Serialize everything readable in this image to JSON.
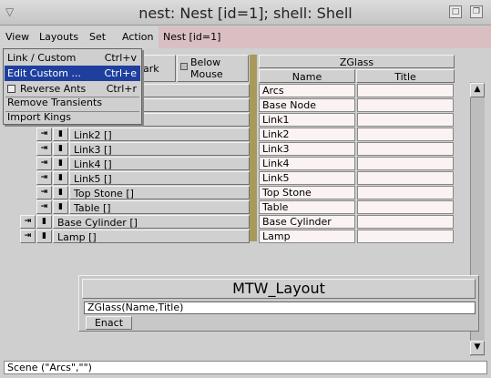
{
  "window": {
    "title": "nest: Nest [id=1]; shell: Shell",
    "menu_icon": "triangle-down-icon",
    "btn1_glyph": "□",
    "btn2_glyph": "❐"
  },
  "menubar": {
    "items": [
      "View",
      "Layouts",
      "Set",
      "Action"
    ],
    "nest_label": "Nest [id=1]"
  },
  "dropdown": {
    "items": [
      {
        "label": "Link / Custom",
        "shortcut": "Ctrl+v"
      },
      {
        "label": "Edit Custom ...",
        "shortcut": "Ctrl+e"
      },
      {
        "label": "Reverse Ants",
        "shortcut": "Ctrl+r"
      },
      {
        "label": "Remove Transients",
        "shortcut": ""
      },
      {
        "label": "Import Kings",
        "shortcut": ""
      }
    ]
  },
  "toolbar": {
    "mark_label": "ark",
    "below_label1": "Below",
    "below_label2": "Mouse"
  },
  "zglass": {
    "title": "ZGlass",
    "col_name": "Name",
    "col_title": "Title"
  },
  "tree_rows": [
    {
      "label": "Link2 []"
    },
    {
      "label": "Link3 []"
    },
    {
      "label": "Link4 []"
    },
    {
      "label": "Link5 []"
    },
    {
      "label": "Top Stone []"
    },
    {
      "label": "Table []"
    },
    {
      "label": "Base Cylinder []"
    },
    {
      "label": "Lamp []"
    }
  ],
  "table_rows": [
    {
      "name": "Arcs",
      "title": ""
    },
    {
      "name": "Base Node",
      "title": ""
    },
    {
      "name": "Link1",
      "title": ""
    },
    {
      "name": "Link2",
      "title": ""
    },
    {
      "name": "Link3",
      "title": ""
    },
    {
      "name": "Link4",
      "title": ""
    },
    {
      "name": "Link5",
      "title": ""
    },
    {
      "name": "Top Stone",
      "title": ""
    },
    {
      "name": "Table",
      "title": ""
    },
    {
      "name": "Base Cylinder",
      "title": ""
    },
    {
      "name": "Lamp",
      "title": ""
    }
  ],
  "mtw": {
    "title": "MTW_Layout",
    "input_value": "ZGlass(Name,Title)",
    "enact_label": "Enact"
  },
  "status": {
    "text": "Scene (\"Arcs\",\"\")"
  },
  "colors": {
    "selection": "#1f3f9f",
    "nest_bg": "#d9bfc2",
    "cell_bg": "#fbf2f2",
    "olive": "#a89a5c"
  }
}
